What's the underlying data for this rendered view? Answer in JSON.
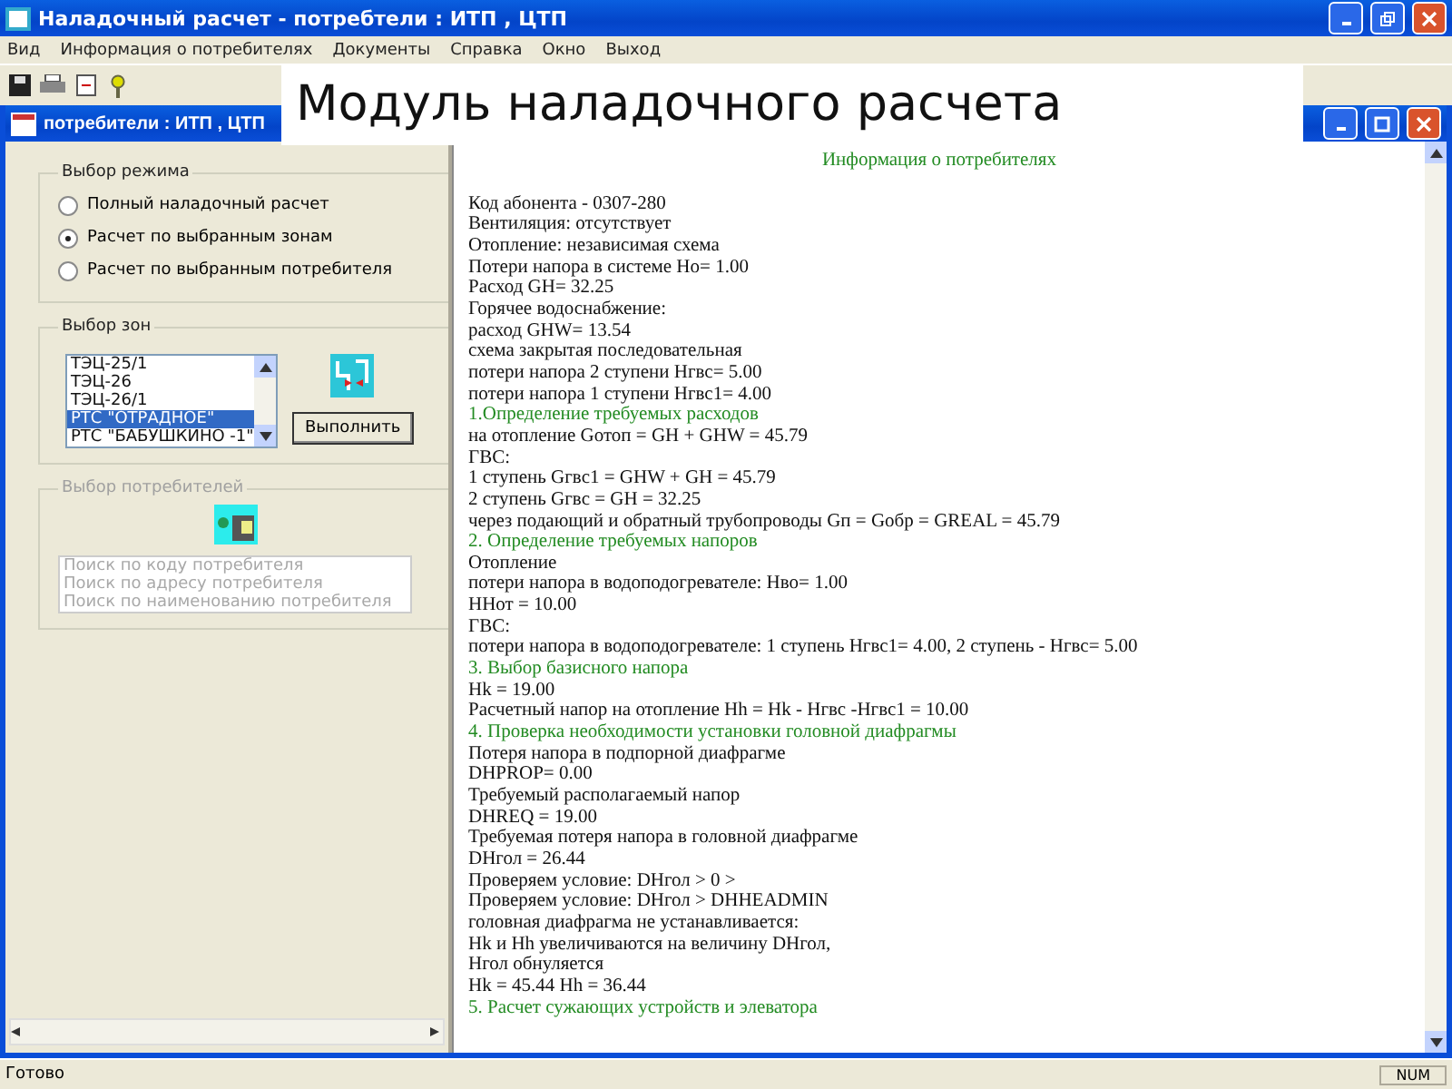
{
  "window": {
    "title": "Наладочный расчет - потребтели : ИТП , ЦТП"
  },
  "menu": [
    "Вид",
    "Информация о потребителях",
    "Документы",
    "Справка",
    "Окно",
    "Выход"
  ],
  "toolbar": [
    {
      "kind": "save"
    },
    {
      "kind": "print"
    },
    {
      "kind": "document"
    },
    {
      "kind": "help"
    }
  ],
  "banner": "Модуль наладочного расчета",
  "child_window": {
    "title": "потребители : ИТП , ЦТП"
  },
  "mode_group": {
    "title": "Выбор режима",
    "options": [
      {
        "label": "Полный наладочный расчет",
        "selected": false
      },
      {
        "label": "Расчет по выбранным зонам",
        "selected": true
      },
      {
        "label": "Расчет по выбранным потребителя",
        "selected": false
      }
    ]
  },
  "zones_group": {
    "title": "Выбор зон",
    "items": [
      {
        "label": "ТЭЦ-25/1",
        "selected": false
      },
      {
        "label": "ТЭЦ-26",
        "selected": false
      },
      {
        "label": "ТЭЦ-26/1",
        "selected": false
      },
      {
        "label": "РТС \"ОТРАДНОЕ\"",
        "selected": true
      },
      {
        "label": "РТС \"БАБУШКИНО -1\"",
        "selected": false
      }
    ],
    "button": "Выполнить"
  },
  "consumers_group": {
    "title": "Выбор потребителей",
    "disabled": true,
    "items": [
      "Поиск по коду потребителя",
      "Поиск по адресу потребителя",
      "Поиск по наименованию потребителя"
    ]
  },
  "report": {
    "title": "Информация о потребителях",
    "lines": [
      {
        "kind": "text",
        "text": "Код абонента - 0307-280"
      },
      {
        "kind": "text",
        "text": "Вентиляция: отсутствует"
      },
      {
        "kind": "text",
        "text": "Отопление: независимая схема"
      },
      {
        "kind": "text",
        "text": "Потери напора в системе Ho= 1.00"
      },
      {
        "kind": "text",
        "text": "Расход GH= 32.25"
      },
      {
        "kind": "text",
        "text": "Горячее водоснабжение:"
      },
      {
        "kind": "text",
        "text": "расход GHW= 13.54"
      },
      {
        "kind": "text",
        "text": "схема закрытая последовательная"
      },
      {
        "kind": "text",
        "text": "потери напора 2 ступени Hгвс= 5.00"
      },
      {
        "kind": "text",
        "text": "потери напора 1 ступени Hгвс1= 4.00"
      },
      {
        "kind": "heading",
        "text": "1.Определение требуемых расходов"
      },
      {
        "kind": "text",
        "text": "на отопление Gотоп = GH + GHW = 45.79"
      },
      {
        "kind": "text",
        "text": "ГВС:"
      },
      {
        "kind": "text",
        "text": "1 ступень Gгвс1 = GHW + GH = 45.79"
      },
      {
        "kind": "text",
        "text": "2 ступень Gгвс = GH = 32.25"
      },
      {
        "kind": "text",
        "text": "через подающий и обратный трубопроводы Gп = Gобр = GREAL = 45.79"
      },
      {
        "kind": "heading",
        "text": "2. Определение требуемых напоров"
      },
      {
        "kind": "text",
        "text": "Отопление"
      },
      {
        "kind": "text",
        "text": "потери напора в водоподогревателе: Hво= 1.00"
      },
      {
        "kind": "text",
        "text": "HHот = 10.00"
      },
      {
        "kind": "text",
        "text": "ГВС:"
      },
      {
        "kind": "text",
        "text": "потери напора в водоподогревателе: 1 ступень Hгвс1= 4.00, 2 ступень - Hгвс= 5.00"
      },
      {
        "kind": "heading",
        "text": "3. Выбор базисного напора"
      },
      {
        "kind": "text",
        "text": "Hk = 19.00"
      },
      {
        "kind": "text",
        "text": "Расчетный напор на отопление Hh = Hk - Hгвс -Hгвс1 = 10.00"
      },
      {
        "kind": "heading",
        "text": "4. Проверка необходимости установки головной диафрагмы"
      },
      {
        "kind": "text",
        "text": "Потеря напора в подпорной диафрагме"
      },
      {
        "kind": "text",
        "text": "DHPROP= 0.00"
      },
      {
        "kind": "text",
        "text": "Требуемый располагаемый напор"
      },
      {
        "kind": "text",
        "text": "DHREQ = 19.00"
      },
      {
        "kind": "text",
        "text": "Требуемая потеря напора в головной диафрагме"
      },
      {
        "kind": "text",
        "text": "DHгол = 26.44"
      },
      {
        "kind": "text",
        "text": "Проверяем условие: DHгол > 0 >"
      },
      {
        "kind": "text",
        "text": "Проверяем условие: DHгол > DHHEADMIN"
      },
      {
        "kind": "text",
        "text": "головная диафрагма не устанавливается:"
      },
      {
        "kind": "text",
        "text": "Hk и Hh увеличиваются на величину DHгол,"
      },
      {
        "kind": "text",
        "text": "Нгол обнуляется"
      },
      {
        "kind": "text",
        "text": "Hk = 45.44 Hh = 36.44"
      },
      {
        "kind": "heading",
        "text": "5. Расчет сужающих устройств и элеватора"
      }
    ]
  },
  "status_bar": {
    "text": "Готово",
    "indicator": "NUM"
  }
}
